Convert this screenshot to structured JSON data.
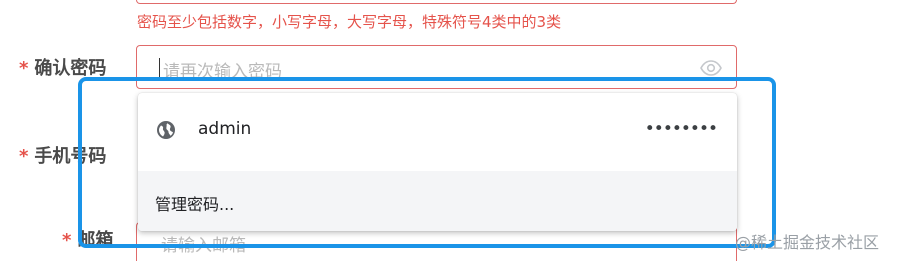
{
  "form": {
    "password_error": "密码至少包括数字，小写字母，大写字母，特殊符号4类中的3类",
    "required_mark": "*",
    "confirm_label": "确认密码",
    "confirm_placeholder": "请再次输入密码",
    "phone_label": "手机号码",
    "email_label": "邮箱",
    "email_placeholder": "请输入邮箱"
  },
  "autofill": {
    "username": "admin",
    "masked_password": "••••••••",
    "manage_label": "管理密码..."
  },
  "icons": {
    "eye": "eye-icon",
    "globe": "globe-icon"
  },
  "colors": {
    "error": "#e5534b",
    "highlight": "#1a94e8"
  },
  "watermark": "@稀土掘金技术社区"
}
